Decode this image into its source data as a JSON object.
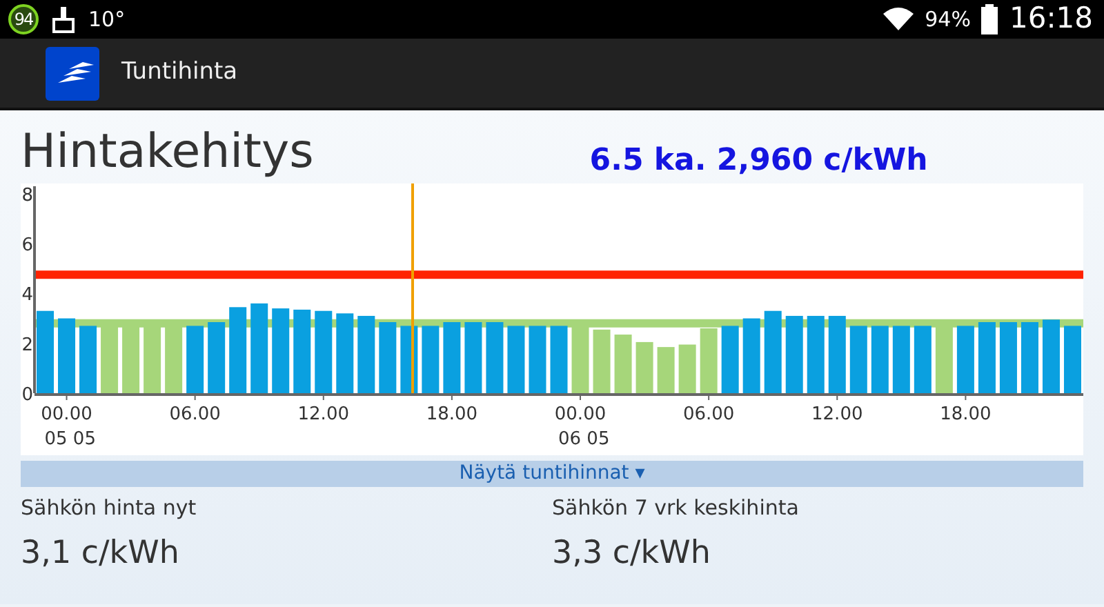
{
  "status_bar": {
    "badge": "94",
    "temperature": "10°",
    "battery": "94%",
    "time": "16:18"
  },
  "app_bar": {
    "title": "Tuntihinta"
  },
  "heading": "Hintakehitys",
  "summary": "6.5 ka. 2,960 c/kWh",
  "chart": {
    "chart_data": {
      "type": "bar",
      "stacked": true,
      "categories": [
        null,
        "00.00",
        null,
        null,
        null,
        null,
        null,
        "06.00",
        null,
        null,
        null,
        null,
        null,
        "12.00",
        null,
        null,
        null,
        null,
        null,
        "18.00",
        null,
        null,
        null,
        null,
        null,
        "00.00",
        null,
        null,
        null,
        null,
        null,
        "06.00",
        null,
        null,
        null,
        null,
        null,
        "12.00",
        null,
        null,
        null,
        null,
        null,
        "18.00",
        null,
        null,
        null,
        null,
        null
      ],
      "series": [
        {
          "color": "#0aa0e0",
          "values": [
            3.3,
            3.0,
            2.7,
            null,
            null,
            null,
            null,
            2.7,
            2.85,
            3.45,
            3.6,
            3.4,
            3.35,
            3.3,
            3.2,
            3.1,
            2.85,
            2.7,
            2.7,
            2.85,
            2.85,
            2.85,
            2.7,
            2.7,
            2.7,
            null,
            null,
            null,
            null,
            null,
            null,
            null,
            2.7,
            3.0,
            3.3,
            3.1,
            3.1,
            3.1,
            2.7,
            2.7,
            2.7,
            2.7,
            null,
            2.7,
            2.85,
            2.85,
            2.85,
            2.95,
            2.7
          ]
        },
        {
          "color": "#a6d67a",
          "values": [
            null,
            null,
            null,
            2.7,
            2.7,
            2.7,
            2.7,
            null,
            null,
            null,
            null,
            null,
            null,
            null,
            null,
            null,
            null,
            null,
            null,
            null,
            null,
            null,
            null,
            null,
            null,
            2.7,
            2.55,
            2.35,
            2.05,
            1.85,
            1.95,
            2.6,
            null,
            null,
            null,
            null,
            null,
            null,
            null,
            null,
            null,
            null,
            2.7,
            null,
            null,
            null,
            null,
            null,
            null
          ]
        }
      ],
      "ylim": [
        0,
        8.3
      ],
      "yticks": [
        0,
        2,
        4,
        6,
        8
      ],
      "ref_lines": [
        {
          "axis": "y",
          "value": 4.75,
          "color": "#ff2200"
        },
        {
          "axis": "y",
          "value": 2.8,
          "color": "#a6d67a"
        }
      ]
    },
    "date_labels": [
      "05 05",
      "06 05"
    ]
  },
  "toggle": {
    "label": "Näytä tuntihinnat",
    "caret": "▾"
  },
  "stats": [
    {
      "label": "Sähkön hinta nyt",
      "value": "3,1 c/kWh"
    },
    {
      "label": "Sähkön 7 vrk keskihinta",
      "value": "3,3 c/kWh"
    }
  ]
}
